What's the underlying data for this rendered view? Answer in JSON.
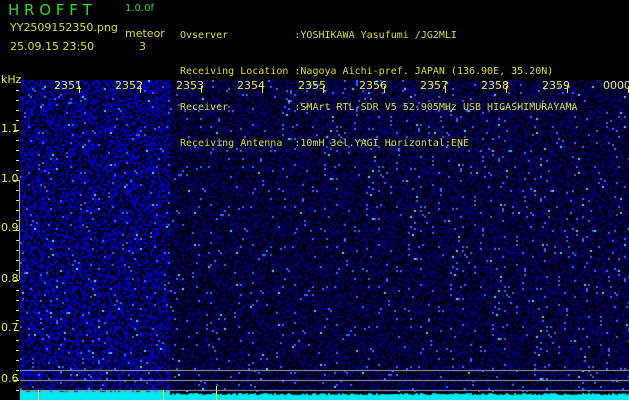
{
  "header": {
    "app_title": "H R O F F T",
    "version": "1.0.0f",
    "filename": "YY2509152350.png",
    "type_label": "meteor",
    "datetime": "25.09.15 23:50",
    "meteor_count": "3"
  },
  "info": [
    {
      "label": "Ovserver           ",
      "value": ":YOSHIKAWA Yasufumi /JG2MLI"
    },
    {
      "label": "Receiving Location ",
      "value": ":Nagoya Aichi-pref. JAPAN (136.90E, 35.20N)"
    },
    {
      "label": "Receiver           ",
      "value": ":SMArt RTL-SDR V5 52.905MHz USB HIGASHIMURAYAMA"
    },
    {
      "label": "Receiving Antenna  ",
      "value": ":10mH 3el.YAGI Horizontal:ENE"
    }
  ],
  "spectrogram": {
    "y_unit": "kHz",
    "x_ticks": [
      "2351",
      "2352",
      "2353",
      "2354",
      "2355",
      "2356",
      "2357",
      "2358",
      "2359",
      "0000"
    ],
    "y_ticks": [
      "1.1",
      "1.0",
      "0.9",
      "0.8",
      "0.7",
      "0.6"
    ],
    "colors": {
      "text": "#eeee22",
      "noise": "#1a1acc",
      "baseline": "#00ffff",
      "grid_line": "#a0a0a0"
    }
  }
}
